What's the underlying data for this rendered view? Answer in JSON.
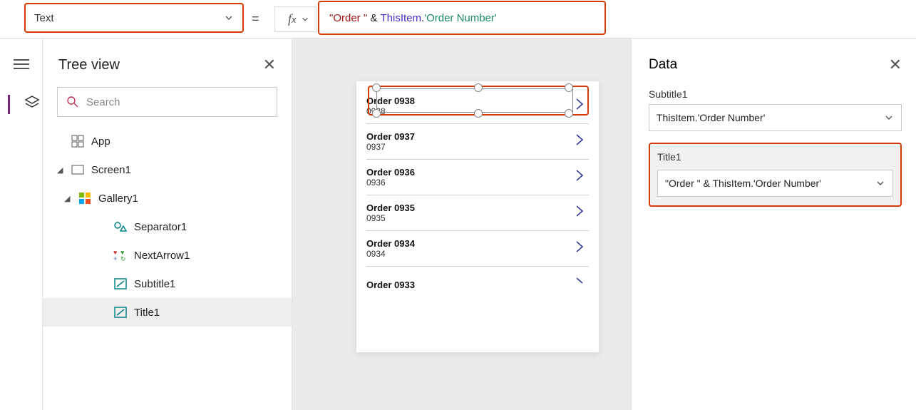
{
  "property_selector": {
    "value": "Text"
  },
  "formula": {
    "prefix": "\"Order \"",
    "amp": " & ",
    "thisitem": "ThisItem",
    "dot": ".",
    "field": "'Order Number'"
  },
  "tree": {
    "title": "Tree view",
    "search_placeholder": "Search",
    "app": "App",
    "screen1": "Screen1",
    "gallery1": "Gallery1",
    "separator1": "Separator1",
    "nextarrow1": "NextArrow1",
    "subtitle1": "Subtitle1",
    "title1": "Title1"
  },
  "canvas_list": [
    {
      "title": "Order 0938",
      "sub": "0938"
    },
    {
      "title": "Order 0937",
      "sub": "0937"
    },
    {
      "title": "Order 0936",
      "sub": "0936"
    },
    {
      "title": "Order 0935",
      "sub": "0935"
    },
    {
      "title": "Order 0934",
      "sub": "0934"
    },
    {
      "title": "Order 0933",
      "sub": ""
    }
  ],
  "data_panel": {
    "title": "Data",
    "subtitle1_label": "Subtitle1",
    "subtitle1_value": "ThisItem.'Order Number'",
    "title1_label": "Title1",
    "title1_value": "\"Order \" & ThisItem.'Order Number'"
  }
}
